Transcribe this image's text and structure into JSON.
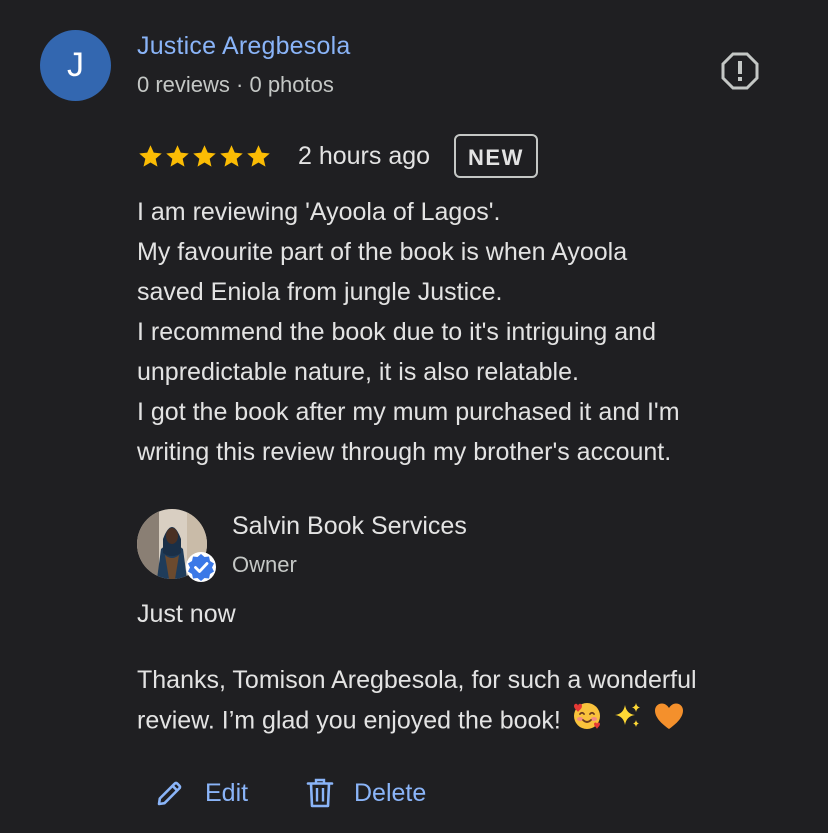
{
  "reviewer": {
    "initial": "J",
    "name": "Justice Aregbesola",
    "meta": "0 reviews · 0 photos"
  },
  "review": {
    "rating": 5,
    "time": "2 hours ago",
    "badge": "NEW",
    "lines": [
      "I am reviewing 'Ayoola of Lagos'.",
      "My favourite part of the book is when Ayoola",
      "saved Eniola from jungle Justice.",
      "I recommend the book due to it's intriguing and",
      "unpredictable nature, it is also relatable.",
      "I got the book after my mum purchased it and I'm",
      "writing this review through my brother's account."
    ]
  },
  "reply": {
    "owner_name": "Salvin Book Services",
    "owner_role": "Owner",
    "time": "Just now",
    "line1": "Thanks, Tomison Aregbesola, for such a wonderful",
    "line2": "review. I’m glad you enjoyed the book!",
    "emojis": [
      "smiling-face-with-hearts",
      "sparkles",
      "orange-heart"
    ]
  },
  "actions": {
    "edit_label": "Edit",
    "delete_label": "Delete"
  },
  "colors": {
    "background": "#1f1f22",
    "accent": "#8ab4f8",
    "avatar": "#3367b0",
    "star": "#fbbc04",
    "verified": "#3b78e7"
  }
}
